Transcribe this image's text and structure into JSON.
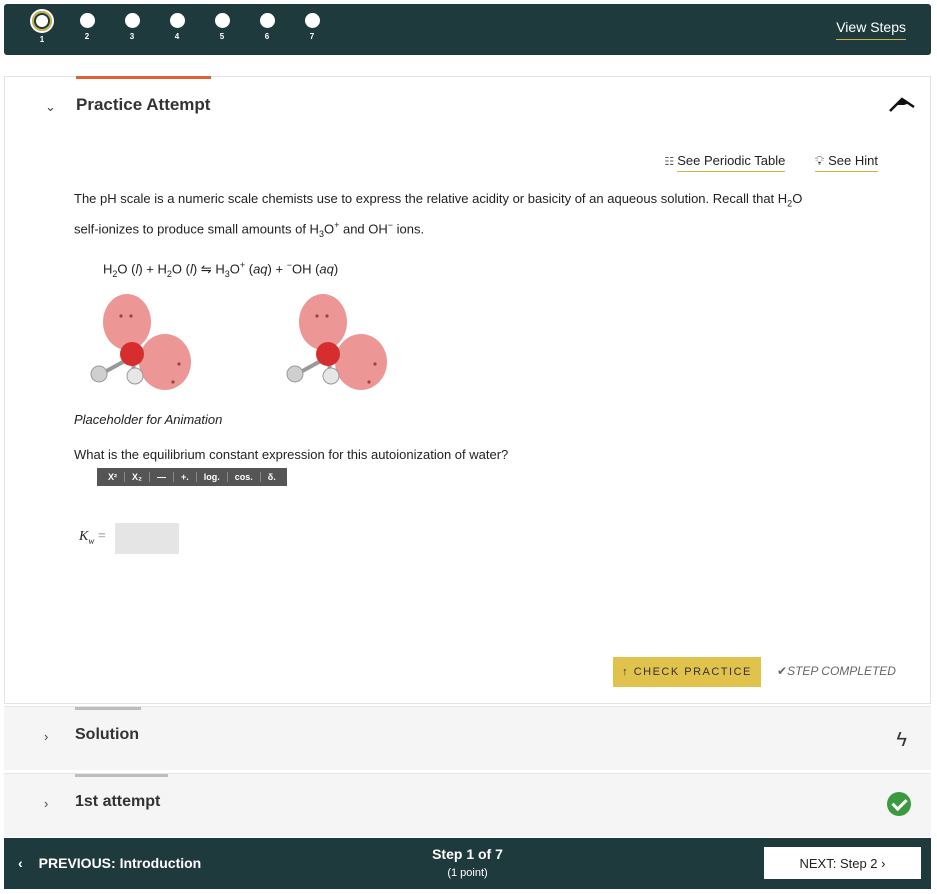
{
  "stepper": {
    "steps": [
      "1",
      "2",
      "3",
      "4",
      "5",
      "6",
      "7"
    ],
    "view_steps": "View Steps"
  },
  "practice": {
    "title": "Practice Attempt",
    "links": {
      "periodic": "See Periodic Table",
      "hint": "See Hint"
    },
    "prompt_a": "The pH scale is a numeric scale chemists use to express the relative acidity or basicity of an aqueous solution.  Recall that H",
    "prompt_b": "O",
    "prompt_c": "self-ionizes to produce small amounts of H",
    "prompt_d": "O",
    "prompt_e": " and OH",
    "prompt_f": " ions.",
    "caption": "Placeholder for Animation",
    "question": "What is the equilibrium constant expression for this autoionization of water?",
    "mathbar": [
      "X²",
      "X₂",
      "—",
      "+.",
      "log.",
      "cos.",
      "δ."
    ],
    "kw_label": "K",
    "kw_sub": "w",
    "kw_eq": " =",
    "check_label": "CHECK PRACTICE",
    "completed": "STEP COMPLETED"
  },
  "sections": {
    "solution": "Solution",
    "first": "1st attempt"
  },
  "footer": {
    "prev": "PREVIOUS: Introduction",
    "step": "Step 1 of 7",
    "points": "(1 point)",
    "next": "NEXT: Step 2"
  },
  "colors": {
    "bar": "#1e3a3d",
    "accent": "#e0c24d",
    "tab": "#e25f37",
    "success": "#3b9a3f"
  }
}
